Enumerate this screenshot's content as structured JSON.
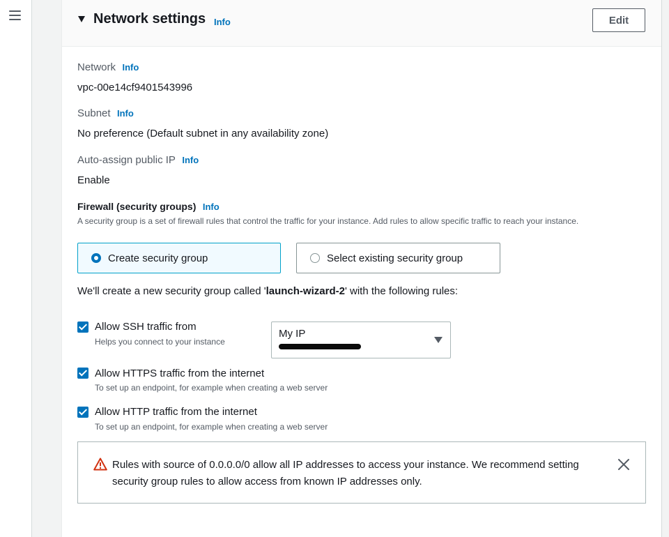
{
  "section": {
    "title": "Network settings",
    "info_label": "Info",
    "edit_label": "Edit"
  },
  "fields": [
    {
      "label": "Network",
      "info": "Info",
      "value": "vpc-00e14cf9401543996"
    },
    {
      "label": "Subnet",
      "info": "Info",
      "value": "No preference (Default subnet in any availability zone)"
    },
    {
      "label": "Auto-assign public IP",
      "info": "Info",
      "value": "Enable"
    }
  ],
  "firewall": {
    "title": "Firewall (security groups)",
    "info": "Info",
    "description": "A security group is a set of firewall rules that control the traffic for your instance. Add rules to allow specific traffic to reach your instance.",
    "options": [
      {
        "label": "Create security group",
        "selected": true
      },
      {
        "label": "Select existing security group",
        "selected": false
      }
    ],
    "intro_prefix": "We'll create a new security group called '",
    "group_name": "launch-wizard-2",
    "intro_suffix": "' with the following rules:"
  },
  "rules": [
    {
      "label": "Allow SSH traffic from",
      "description": "Helps you connect to your instance",
      "checked": true
    },
    {
      "label": "Allow HTTPS traffic from the internet",
      "description": "To set up an endpoint, for example when creating a web server",
      "checked": true
    },
    {
      "label": "Allow HTTP traffic from the internet",
      "description": "To set up an endpoint, for example when creating a web server",
      "checked": true
    }
  ],
  "ssh_source": {
    "selected": "My IP"
  },
  "warning": {
    "text": "Rules with source of 0.0.0.0/0 allow all IP addresses to access your instance. We recommend setting security group rules to allow access from known IP addresses only."
  },
  "colors": {
    "accent": "#0073bb",
    "selected_border": "#00a1c9",
    "warning": "#d13212"
  },
  "icons": {
    "menu": "hamburger-menu-icon",
    "collapse": "caret-down-icon",
    "warning": "warning-triangle-icon",
    "close": "close-icon",
    "dropdown": "caret-down-icon"
  }
}
